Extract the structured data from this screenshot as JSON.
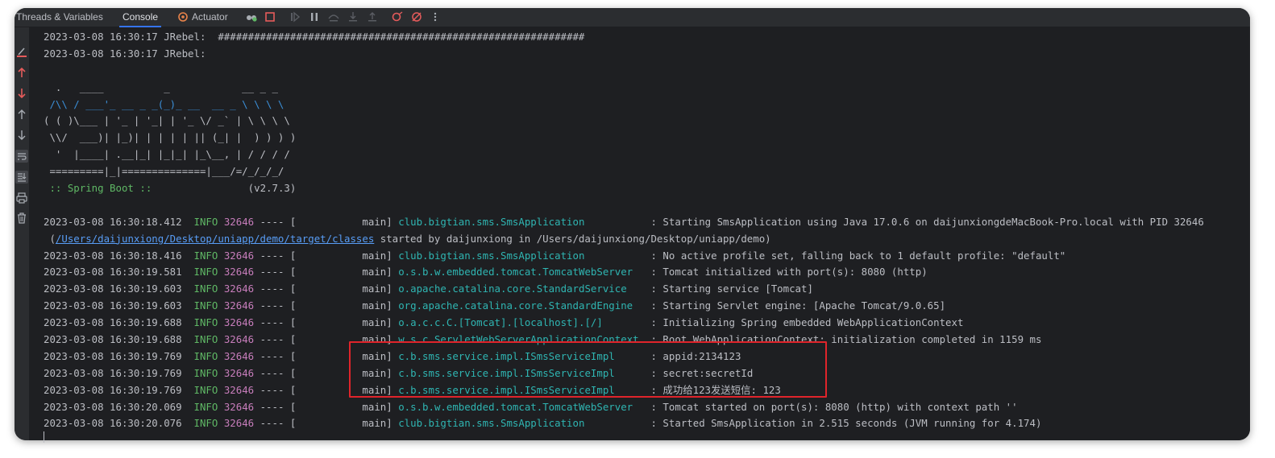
{
  "tabs": {
    "threads": "Threads & Variables",
    "console": "Console",
    "actuator": "Actuator"
  },
  "icons": {
    "toolbar": [
      "glasses-icon",
      "stop-icon",
      "resume-icon",
      "pause-icon",
      "step-over-icon",
      "step-into-icon",
      "step-out-icon",
      "breakpoint-icon",
      "mute-breakpoints-icon",
      "more-icon"
    ],
    "gutter": [
      "clear-icon",
      "up-red-icon",
      "down-red-icon",
      "up-arrow-icon",
      "down-arrow-icon",
      "soft-wrap-icon",
      "scroll-to-end-icon",
      "print-icon",
      "trash-icon"
    ]
  },
  "colors": {
    "background": "#1e1f22",
    "info": "#5fb865",
    "pid": "#c77dbb",
    "logger": "#2fb5b2",
    "highlight": "#e0242b"
  },
  "console": {
    "jrebel1": "2023-03-08 16:30:17 JRebel:  #############################################################",
    "jrebel2": "2023-03-08 16:30:17 JRebel:",
    "banner": [
      "  .   ____          _            __ _ _",
      " /\\\\ / ___'_ __ _ _(_)_ __  __ _ \\ \\ \\ \\",
      "( ( )\\___ | '_ | '_| | '_ \\/ _` | \\ \\ \\ \\",
      " \\\\/  ___)| |_)| | | | | || (_| |  ) ) ) )",
      "  '  |____| .__|_| |_|_| |_\\__, | / / / /",
      " =========|_|==============|___/=/_/_/_/"
    ],
    "spring_boot_label": " :: Spring Boot :: ",
    "spring_boot_version": "               (v2.7.3)",
    "logs": [
      {
        "ts": "2023-03-08 16:30:18.412",
        "level": "INFO",
        "pid": "32646",
        "thread": "---- [           main]",
        "logger": "club.bigtian.sms.SmsApplication          ",
        "msg": ": Starting SmsApplication using Java 17.0.6 on daijunxiongdeMacBook-Pro.local with PID 32646"
      },
      {
        "cont_link": "/Users/daijunxiong/Desktop/uniapp/demo/target/classes",
        "cont_rest": " started by daijunxiong in /Users/daijunxiong/Desktop/uniapp/demo)"
      },
      {
        "ts": "2023-03-08 16:30:18.416",
        "level": "INFO",
        "pid": "32646",
        "thread": "---- [           main]",
        "logger": "club.bigtian.sms.SmsApplication          ",
        "msg": ": No active profile set, falling back to 1 default profile: \"default\""
      },
      {
        "ts": "2023-03-08 16:30:19.581",
        "level": "INFO",
        "pid": "32646",
        "thread": "---- [           main]",
        "logger": "o.s.b.w.embedded.tomcat.TomcatWebServer  ",
        "msg": ": Tomcat initialized with port(s): 8080 (http)"
      },
      {
        "ts": "2023-03-08 16:30:19.603",
        "level": "INFO",
        "pid": "32646",
        "thread": "---- [           main]",
        "logger": "o.apache.catalina.core.StandardService   ",
        "msg": ": Starting service [Tomcat]"
      },
      {
        "ts": "2023-03-08 16:30:19.603",
        "level": "INFO",
        "pid": "32646",
        "thread": "---- [           main]",
        "logger": "org.apache.catalina.core.StandardEngine  ",
        "msg": ": Starting Servlet engine: [Apache Tomcat/9.0.65]"
      },
      {
        "ts": "2023-03-08 16:30:19.688",
        "level": "INFO",
        "pid": "32646",
        "thread": "---- [           main]",
        "logger": "o.a.c.c.C.[Tomcat].[localhost].[/]       ",
        "msg": ": Initializing Spring embedded WebApplicationContext"
      },
      {
        "ts": "2023-03-08 16:30:19.688",
        "level": "INFO",
        "pid": "32646",
        "thread": "---- [           main]",
        "logger": "w.s.c.ServletWebServerApplicationContext ",
        "msg": ": Root WebApplicationContext: initialization completed in 1159 ms"
      },
      {
        "ts": "2023-03-08 16:30:19.769",
        "level": "INFO",
        "pid": "32646",
        "thread": "---- [           main]",
        "logger": "c.b.sms.service.impl.ISmsServiceImpl     ",
        "msg": ": appid:2134123"
      },
      {
        "ts": "2023-03-08 16:30:19.769",
        "level": "INFO",
        "pid": "32646",
        "thread": "---- [           main]",
        "logger": "c.b.sms.service.impl.ISmsServiceImpl     ",
        "msg": ": secret:secretId"
      },
      {
        "ts": "2023-03-08 16:30:19.769",
        "level": "INFO",
        "pid": "32646",
        "thread": "---- [           main]",
        "logger": "c.b.sms.service.impl.ISmsServiceImpl     ",
        "msg": ": 成功给123发送短信: 123"
      },
      {
        "ts": "2023-03-08 16:30:20.069",
        "level": "INFO",
        "pid": "32646",
        "thread": "---- [           main]",
        "logger": "o.s.b.w.embedded.tomcat.TomcatWebServer  ",
        "msg": ": Tomcat started on port(s): 8080 (http) with context path ''"
      },
      {
        "ts": "2023-03-08 16:30:20.076",
        "level": "INFO",
        "pid": "32646",
        "thread": "---- [           main]",
        "logger": "club.bigtian.sms.SmsApplication          ",
        "msg": ": Started SmsApplication in 2.515 seconds (JVM running for 4.174)"
      }
    ]
  }
}
